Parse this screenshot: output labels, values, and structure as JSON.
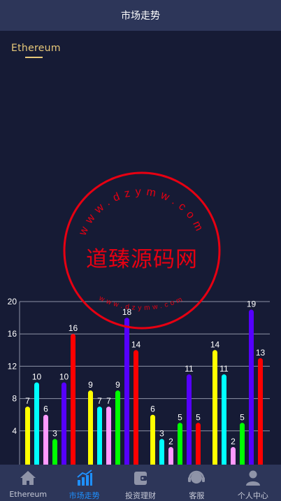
{
  "header": {
    "title": "市场走势"
  },
  "tab": {
    "label": "Ethereum"
  },
  "stamp": {
    "ring_text_top": "www.dzymw.com",
    "ring_text_bottom": "www.dzymw.com",
    "center_text": "道臻源码网",
    "color": "#e60012"
  },
  "nav": {
    "items": [
      {
        "label": "Ethereum",
        "icon": "home-icon",
        "active": false
      },
      {
        "label": "市场走势",
        "icon": "bar-chart-icon",
        "active": true
      },
      {
        "label": "投资理财",
        "icon": "wallet-icon",
        "active": false
      },
      {
        "label": "客服",
        "icon": "headset-icon",
        "active": false
      },
      {
        "label": "个人中心",
        "icon": "user-icon",
        "active": false
      }
    ]
  },
  "colors": {
    "background": "#161b35",
    "bar_header": "#2d3659",
    "accent_gold": "#e8c97a",
    "nav_active": "#1e90ff",
    "series": [
      "#ffff00",
      "#00ffff",
      "#ff99ff",
      "#00ff00",
      "#5500ff",
      "#ff0000"
    ]
  },
  "chart_data": {
    "type": "bar",
    "ylim": [
      0,
      20
    ],
    "yticks": [
      4,
      8,
      12,
      16,
      20
    ],
    "grid": true,
    "groups": [
      [
        7,
        10,
        6,
        3,
        10,
        16
      ],
      [
        9,
        7,
        7,
        9,
        18,
        14
      ],
      [
        6,
        3,
        2,
        5,
        11,
        5
      ],
      [
        14,
        11,
        2,
        5,
        19,
        13
      ]
    ]
  }
}
